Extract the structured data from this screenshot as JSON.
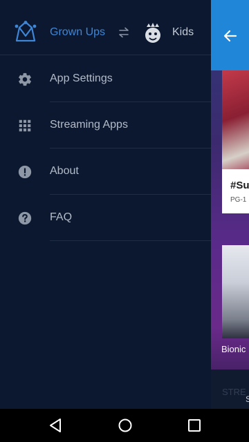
{
  "drawer": {
    "profiles": {
      "grown_label": "Grown Ups",
      "kids_label": "Kids"
    },
    "menu": [
      {
        "label": "App Settings",
        "icon": "gear-icon"
      },
      {
        "label": "Streaming Apps",
        "icon": "grid-icon"
      },
      {
        "label": "About",
        "icon": "info-exclamation-icon"
      },
      {
        "label": "FAQ",
        "icon": "question-icon"
      }
    ]
  },
  "content": {
    "card1_title": "#Su",
    "card1_sub": "PG-1",
    "card2_title": "Bionic",
    "card3_label": "STRE",
    "card3_s": "S"
  },
  "colors": {
    "accent": "#3f86d6",
    "appbar": "#1f86d8",
    "drawer_bg": "#0b1830"
  }
}
